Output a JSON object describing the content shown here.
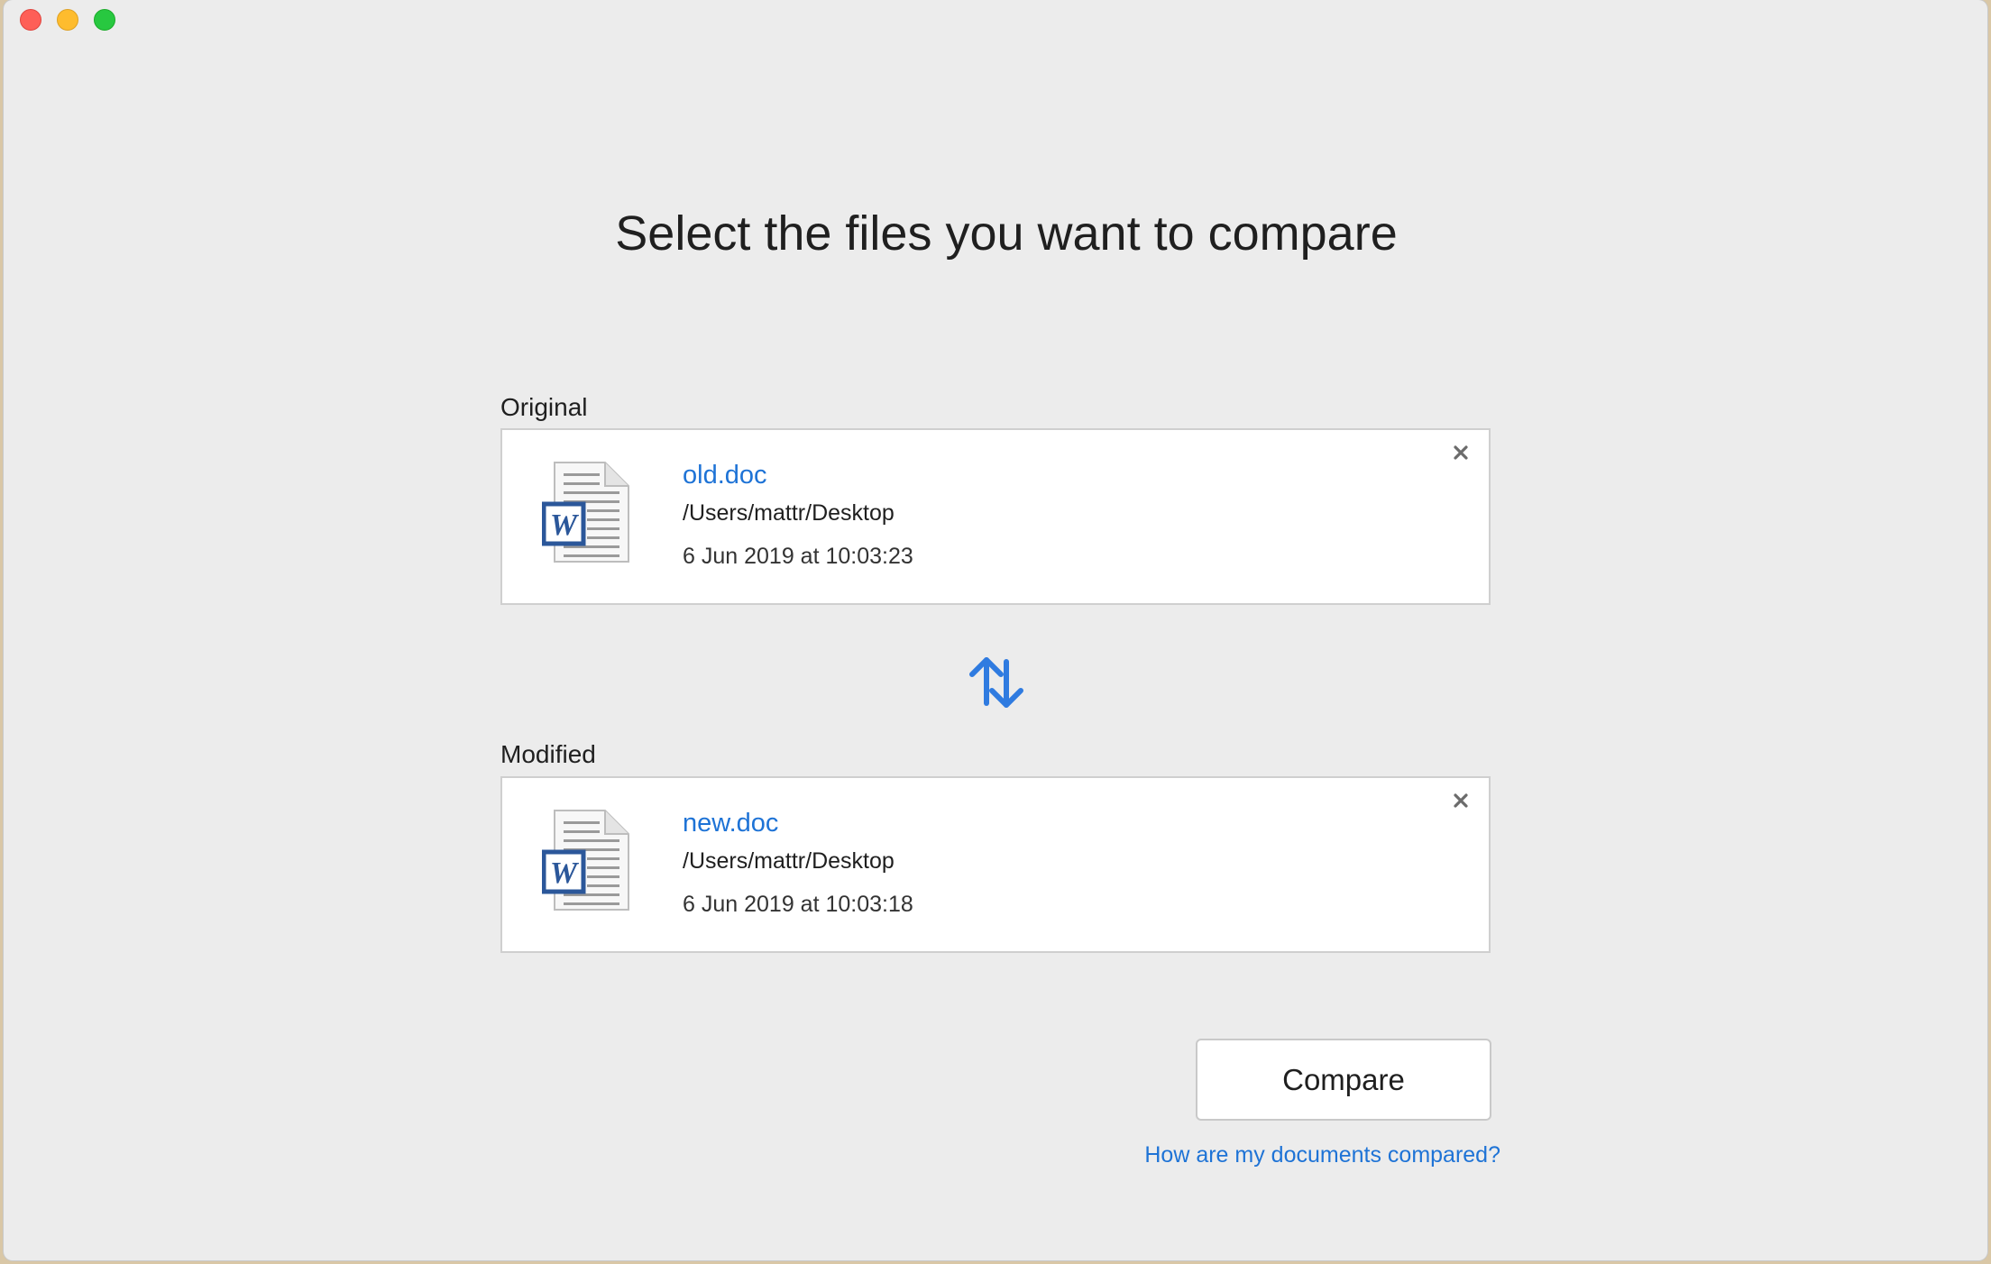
{
  "window": {
    "title": ""
  },
  "page_title": "Select the files you want to compare",
  "original": {
    "label": "Original",
    "file_name": "old.doc",
    "path": "/Users/mattr/Desktop",
    "date": "6 Jun 2019 at 10:03:23",
    "icon": "word-document-icon"
  },
  "modified": {
    "label": "Modified",
    "file_name": "new.doc",
    "path": "/Users/mattr/Desktop",
    "date": "6 Jun 2019 at 10:03:18",
    "icon": "word-document-icon"
  },
  "swap_icon": "swap-arrows-icon",
  "remove_icon": "close-icon",
  "compare_button": "Compare",
  "help_link": "How are my documents compared?",
  "colors": {
    "accent": "#1e73d6",
    "swap_arrows": "#2f7be0",
    "word_blue": "#2b579a"
  }
}
